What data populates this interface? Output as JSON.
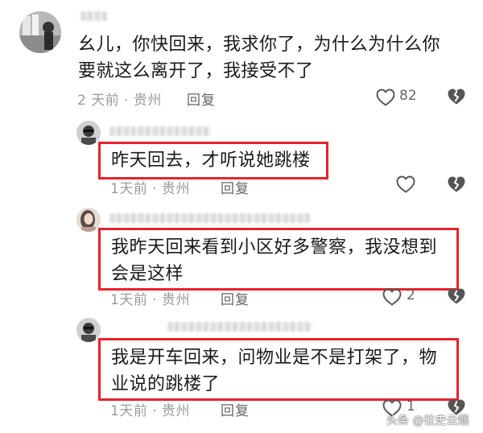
{
  "comments": [
    {
      "text_line1": "幺儿，你快回来，我求你了，为什么为什么你",
      "text_line2": "要就这么离开了，我接受不了",
      "meta": "2 天前 · 贵州",
      "reply_label": "回复",
      "like_count": "82",
      "avatar_icon": "person-photo-avatar",
      "highlighted": false
    },
    {
      "text_line1": "昨天回去，才听说她跳楼",
      "text_line2": "",
      "meta": "1天前 · 贵州",
      "reply_label": "回复",
      "like_count": "",
      "avatar_icon": "person-photo-avatar",
      "highlighted": true
    },
    {
      "text_line1": "我昨天回来看到小区好多警察，我没想到",
      "text_line2": "会是这样",
      "meta": "1天前 · 贵州",
      "reply_label": "回复",
      "like_count": "2",
      "avatar_icon": "person-photo-avatar",
      "highlighted": true
    },
    {
      "text_line1": "我是开车回来，问物业是不是打架了，物",
      "text_line2": "业说的跳楼了",
      "meta": "1天前 · 贵州",
      "reply_label": "回复",
      "like_count": "1",
      "avatar_icon": "person-photo-avatar",
      "highlighted": true
    }
  ],
  "icons": {
    "like": "heart-outline-icon",
    "dislike": "broken-heart-icon"
  },
  "colors": {
    "highlight_border": "#e8222b",
    "meta_text": "#9a9a9a"
  },
  "watermark": {
    "text": "头条 @往史云烟"
  }
}
